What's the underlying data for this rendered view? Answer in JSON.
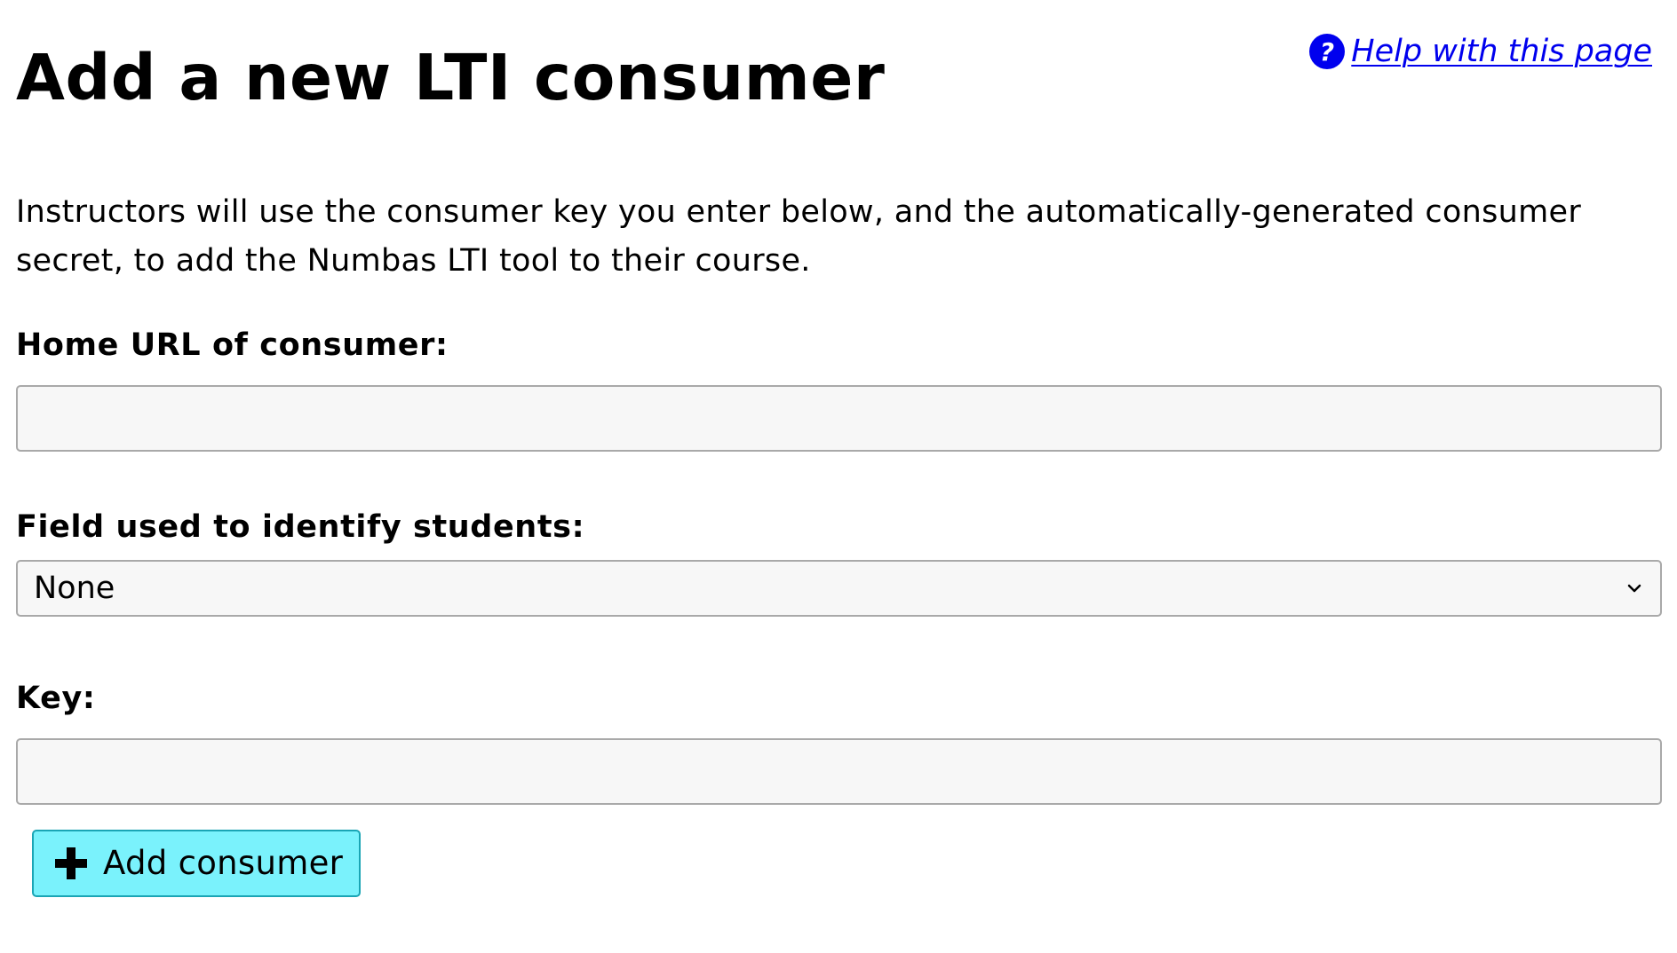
{
  "header": {
    "title": "Add a new LTI consumer",
    "help_link_label": " Help with this page",
    "help_icon": "question-circle-icon"
  },
  "intro_text": "Instructors will use the consumer key you enter below, and the automatically-generated consumer secret, to add the Numbas LTI tool to their course.",
  "form": {
    "home_url": {
      "label": "Home URL of consumer:",
      "value": "",
      "placeholder": ""
    },
    "identify_field": {
      "label": "Field used to identify students:",
      "selected": "None",
      "icon": "chevron-down-icon"
    },
    "key": {
      "label": "Key:",
      "value": "",
      "placeholder": ""
    },
    "submit": {
      "label": "Add consumer",
      "icon": "plus-icon",
      "color": "#7af2fc"
    }
  },
  "colors": {
    "link": "#0000ee",
    "button_bg": "#7af2fc",
    "input_bg": "#f7f7f7"
  }
}
